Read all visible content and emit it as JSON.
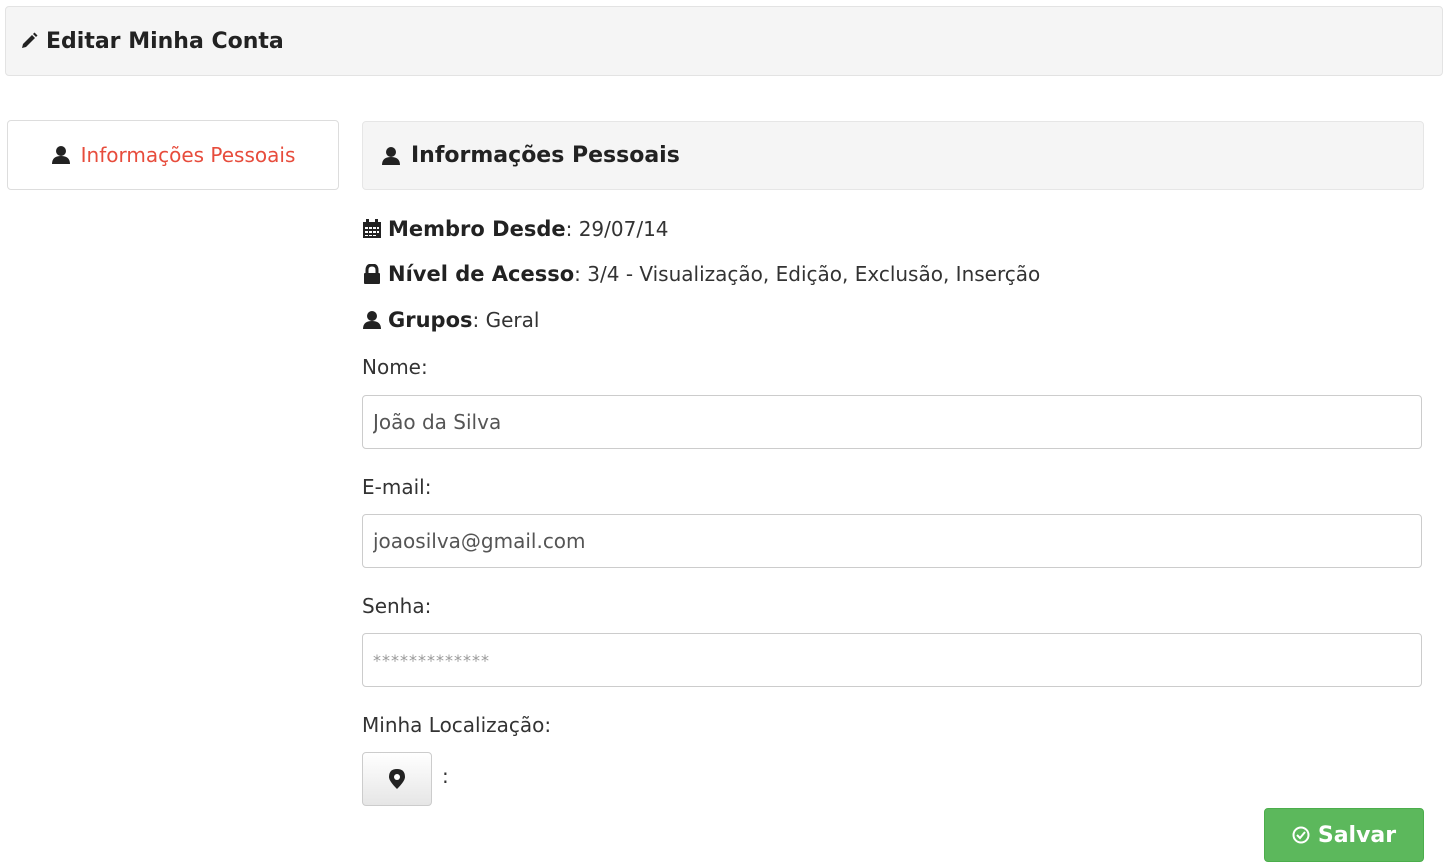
{
  "header": {
    "title": "Editar Minha Conta",
    "icon": "pencil-icon"
  },
  "sidebar": {
    "items": [
      {
        "label": "Informações Pessoais",
        "icon": "user-icon",
        "active": true
      }
    ]
  },
  "panel": {
    "title": "Informações Pessoais",
    "icon": "user-icon"
  },
  "info": {
    "member_since": {
      "label": "Membro Desde",
      "value": ": 29/07/14",
      "icon": "calendar-icon"
    },
    "access_level": {
      "label": "Nível de Acesso",
      "value": ": 3/4 - Visualização, Edição, Exclusão, Inserção",
      "icon": "lock-icon"
    },
    "groups": {
      "label": "Grupos",
      "value": ": Geral",
      "icon": "user-icon"
    }
  },
  "form": {
    "name": {
      "label": "Nome:",
      "value": "João da Silva"
    },
    "email": {
      "label": "E-mail:",
      "value": "joaosilva@gmail.com"
    },
    "password": {
      "label": "Senha:",
      "value": "*************"
    },
    "location": {
      "label": "Minha Localização:",
      "icon": "map-marker-icon",
      "value": ":"
    }
  },
  "actions": {
    "save_label": "Salvar",
    "save_icon": "check-circle-icon"
  },
  "colors": {
    "accent_red": "#e74c3c",
    "save_green": "#5cb85c",
    "panel_bg": "#f5f5f5"
  }
}
